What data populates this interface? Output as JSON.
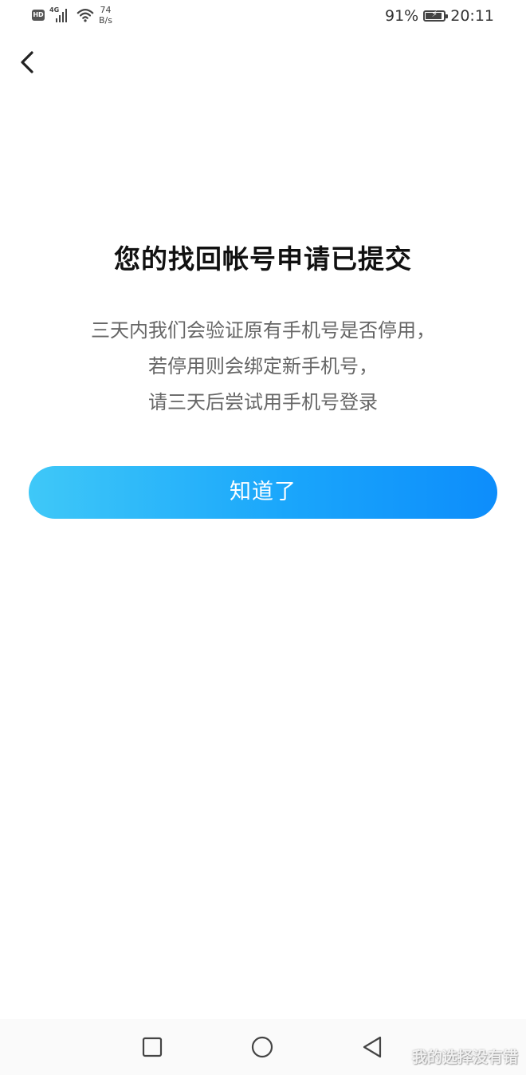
{
  "status_bar": {
    "hd": "HD",
    "network_type": "4G",
    "net_speed_value": "74",
    "net_speed_unit": "B/s",
    "battery_percent": "91%",
    "battery_level": 0.91,
    "time": "20:11",
    "icons": [
      "hd-icon",
      "signal-icon",
      "wifi-icon",
      "battery-icon"
    ]
  },
  "header": {
    "back_icon": "chevron-left-icon"
  },
  "main": {
    "title": "您的找回帐号申请已提交",
    "description_lines": [
      "三天内我们会验证原有手机号是否停用，",
      "若停用则会绑定新手机号，",
      "请三天后尝试用手机号登录"
    ],
    "confirm_label": "知道了"
  },
  "nav_bar": {
    "icons": [
      "recents-square-icon",
      "home-circle-icon",
      "back-triangle-icon"
    ]
  },
  "watermark": "我的选择没有错",
  "colors": {
    "button_gradient_start": "#3fc8f8",
    "button_gradient_end": "#0d8dfb",
    "title": "#111111",
    "description": "#666666"
  }
}
